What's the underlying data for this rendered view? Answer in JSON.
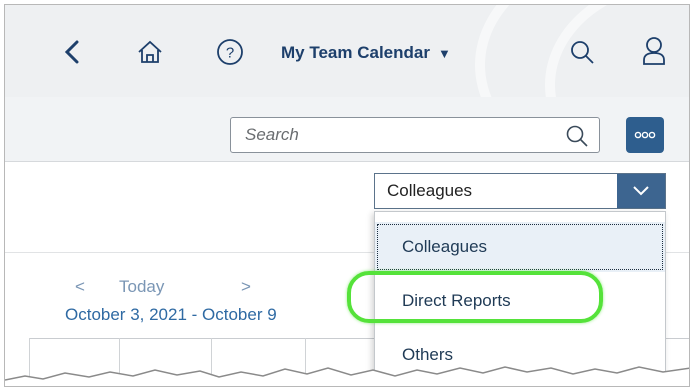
{
  "shell": {
    "title": "My Team Calendar",
    "icons": [
      "back-icon",
      "home-icon",
      "help-icon",
      "caret-down-icon",
      "search-icon",
      "user-icon"
    ]
  },
  "search": {
    "placeholder": "Search",
    "value": ""
  },
  "more_button": {
    "icon": "more-icon"
  },
  "calendar": {
    "prev_label": "<",
    "today_label": "Today",
    "next_label": ">",
    "date_range": "October 3, 2021 - October 9"
  },
  "view_select": {
    "value": "Colleagues",
    "options": [
      "Colleagues",
      "Direct Reports",
      "Others"
    ],
    "selected_index": 0,
    "highlighted_option": "Direct Reports"
  },
  "colors": {
    "brand": "#1d3f6b",
    "button": "#2e5e8e",
    "link": "#2f6aa3",
    "highlight": "#55e23a"
  }
}
